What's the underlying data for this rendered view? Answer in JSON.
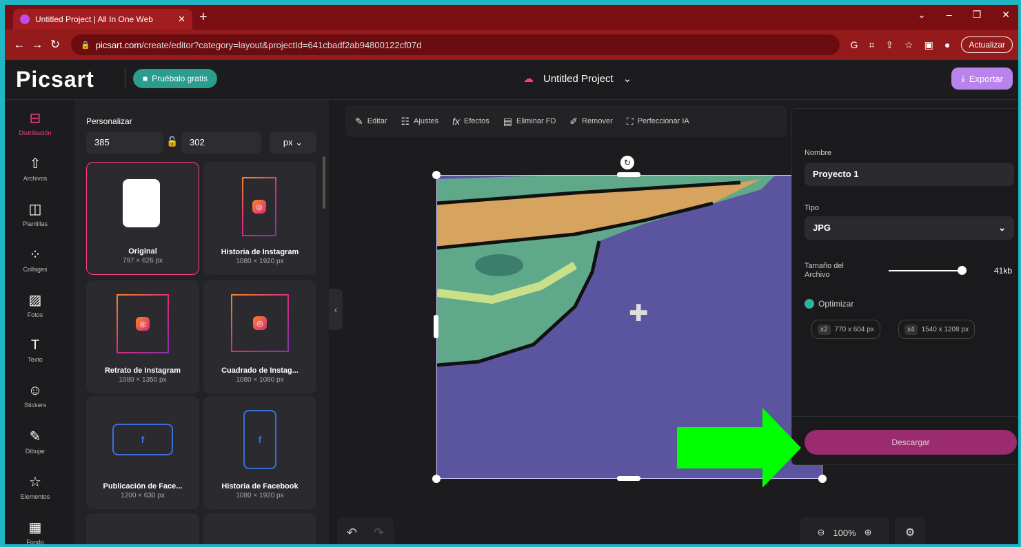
{
  "browser": {
    "tab_title": "Untitled Project | All In One Web",
    "url_domain": "picsart.com",
    "url_path": "/create/editor?category=layout&projectId=641cbadf2ab94800122cf07d",
    "update_label": "Actualizar"
  },
  "header": {
    "logo": "Picsart",
    "try_label": "Pruébalo gratis",
    "project_title": "Untitled Project",
    "export_label": "Exportar"
  },
  "rail": [
    {
      "label": "Distribución",
      "icon": "layout-icon"
    },
    {
      "label": "Archivos",
      "icon": "upload-icon"
    },
    {
      "label": "Plantillas",
      "icon": "templates-icon"
    },
    {
      "label": "Collages",
      "icon": "collage-icon"
    },
    {
      "label": "Fotos",
      "icon": "photo-icon"
    },
    {
      "label": "Texto",
      "icon": "text-icon"
    },
    {
      "label": "Stickers",
      "icon": "sticker-icon"
    },
    {
      "label": "Dibujar",
      "icon": "brush-icon"
    },
    {
      "label": "Elementos",
      "icon": "star-icon"
    },
    {
      "label": "Fondo",
      "icon": "background-icon"
    }
  ],
  "panel": {
    "title": "Personalizar",
    "width": "385",
    "height": "302",
    "unit": "px",
    "cards": [
      {
        "name": "Original",
        "size": "797 × 626 px"
      },
      {
        "name": "Historia de Instagram",
        "size": "1080 × 1920 px"
      },
      {
        "name": "Retrato de Instagram",
        "size": "1080 × 1350 px"
      },
      {
        "name": "Cuadrado de Instag...",
        "size": "1080 × 1080 px"
      },
      {
        "name": "Publicación de Face...",
        "size": "1200 × 630 px"
      },
      {
        "name": "Historia de Facebook",
        "size": "1080 × 1920 px"
      }
    ]
  },
  "toolbar": {
    "editor": "Editar",
    "ajustes": "Ajustes",
    "efectos": "Efectos",
    "eliminar": "Eliminar FD",
    "remover": "Remover",
    "perfeccionar": "Perfeccionar IA"
  },
  "export": {
    "name_label": "Nombre",
    "name_value": "Proyecto 1",
    "type_label": "Tipo",
    "type_value": "JPG",
    "size_label": "Tamaño del Archivo",
    "size_value": "41kb",
    "optimize_label": "Optimizar",
    "chip1_x": "x2",
    "chip1": "770 x 604 px",
    "chip2_x": "x4",
    "chip2": "1540 x 1208 px",
    "download_label": "Descargar"
  },
  "zoom": {
    "level": "100%"
  },
  "colors": {
    "accent": "#ff3b8a",
    "canvas": "#5b55a0",
    "export": "#b983ee",
    "arrow": "#00ff00"
  }
}
